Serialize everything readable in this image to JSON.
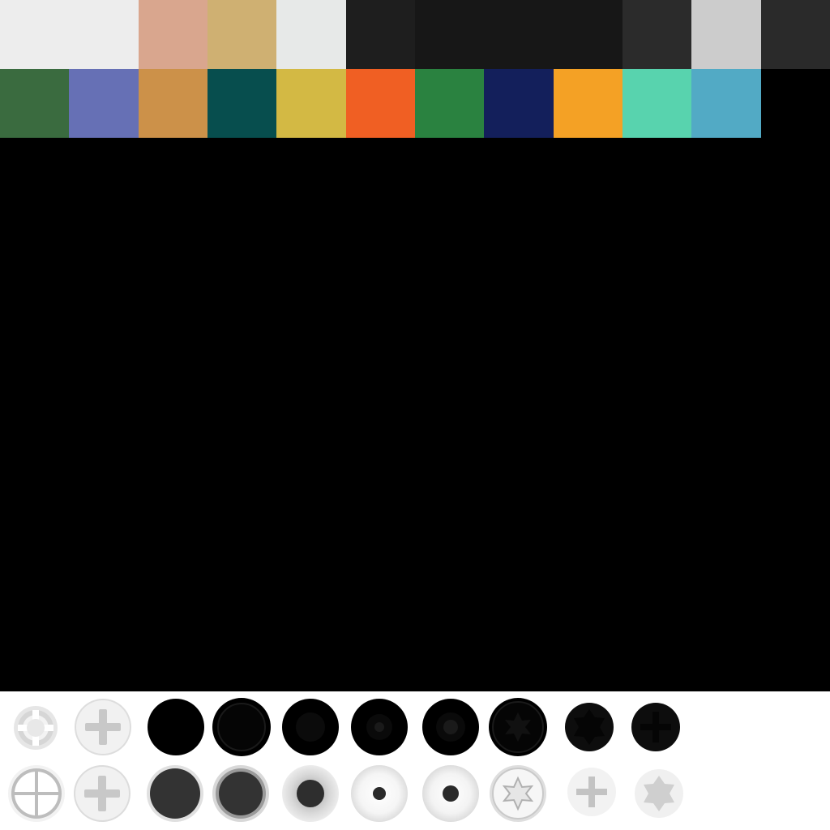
{
  "palette": {
    "row1": [
      "#ededed",
      "#ededed",
      "#d9a68e",
      "#cfb072",
      "#e7e9e8",
      "#1e1e1e",
      "#171717",
      "#171717",
      "#171717",
      "#2b2b2b",
      "#cccccc",
      "#2a2a2a"
    ],
    "row2": [
      "#3a6b3f",
      "#6670b5",
      "#cc9149",
      "#074e4e",
      "#d3b944",
      "#f05f23",
      "#2a8240",
      "#131f5b",
      "#f4a125",
      "#58d3ae",
      "#52aac5"
    ]
  },
  "screws": {
    "top_row": [
      {
        "icon": "crosshair-screw-icon",
        "fill": "#e0e0e0"
      },
      {
        "icon": "phillips-screw-icon",
        "fill": "#ececec"
      },
      {
        "icon": "plain-screw-icon",
        "fill": "#000000"
      },
      {
        "icon": "ringed-screw-icon",
        "fill": "#000000"
      },
      {
        "icon": "recessed-screw-icon",
        "fill": "#000000"
      },
      {
        "icon": "dot-screw-icon",
        "fill": "#000000"
      },
      {
        "icon": "dot-screw-icon",
        "fill": "#000000"
      },
      {
        "icon": "torx-screw-icon",
        "fill": "#000000"
      },
      {
        "icon": "hex-screw-icon",
        "fill": "#0d0d0d"
      },
      {
        "icon": "phillips-screw-icon",
        "fill": "#0d0d0d"
      }
    ],
    "bottom_row": [
      {
        "icon": "slotted-cross-screw-icon",
        "fill": "#f0f0f0"
      },
      {
        "icon": "phillips-screw-icon",
        "fill": "#ececec"
      },
      {
        "icon": "plain-screw-icon",
        "fill": "#333333"
      },
      {
        "icon": "ringed-screw-icon",
        "fill": "#333333"
      },
      {
        "icon": "recessed-screw-icon",
        "fill": "#dcdcdc"
      },
      {
        "icon": "dot-screw-icon",
        "fill": "#eeeeee"
      },
      {
        "icon": "dot-screw-icon",
        "fill": "#eeeeee"
      },
      {
        "icon": "torx-screw-icon",
        "fill": "#eaeaea"
      },
      {
        "icon": "phillips-screw-icon",
        "fill": "#f2f2f2"
      },
      {
        "icon": "hex-screw-icon",
        "fill": "#eeeeee"
      }
    ]
  }
}
